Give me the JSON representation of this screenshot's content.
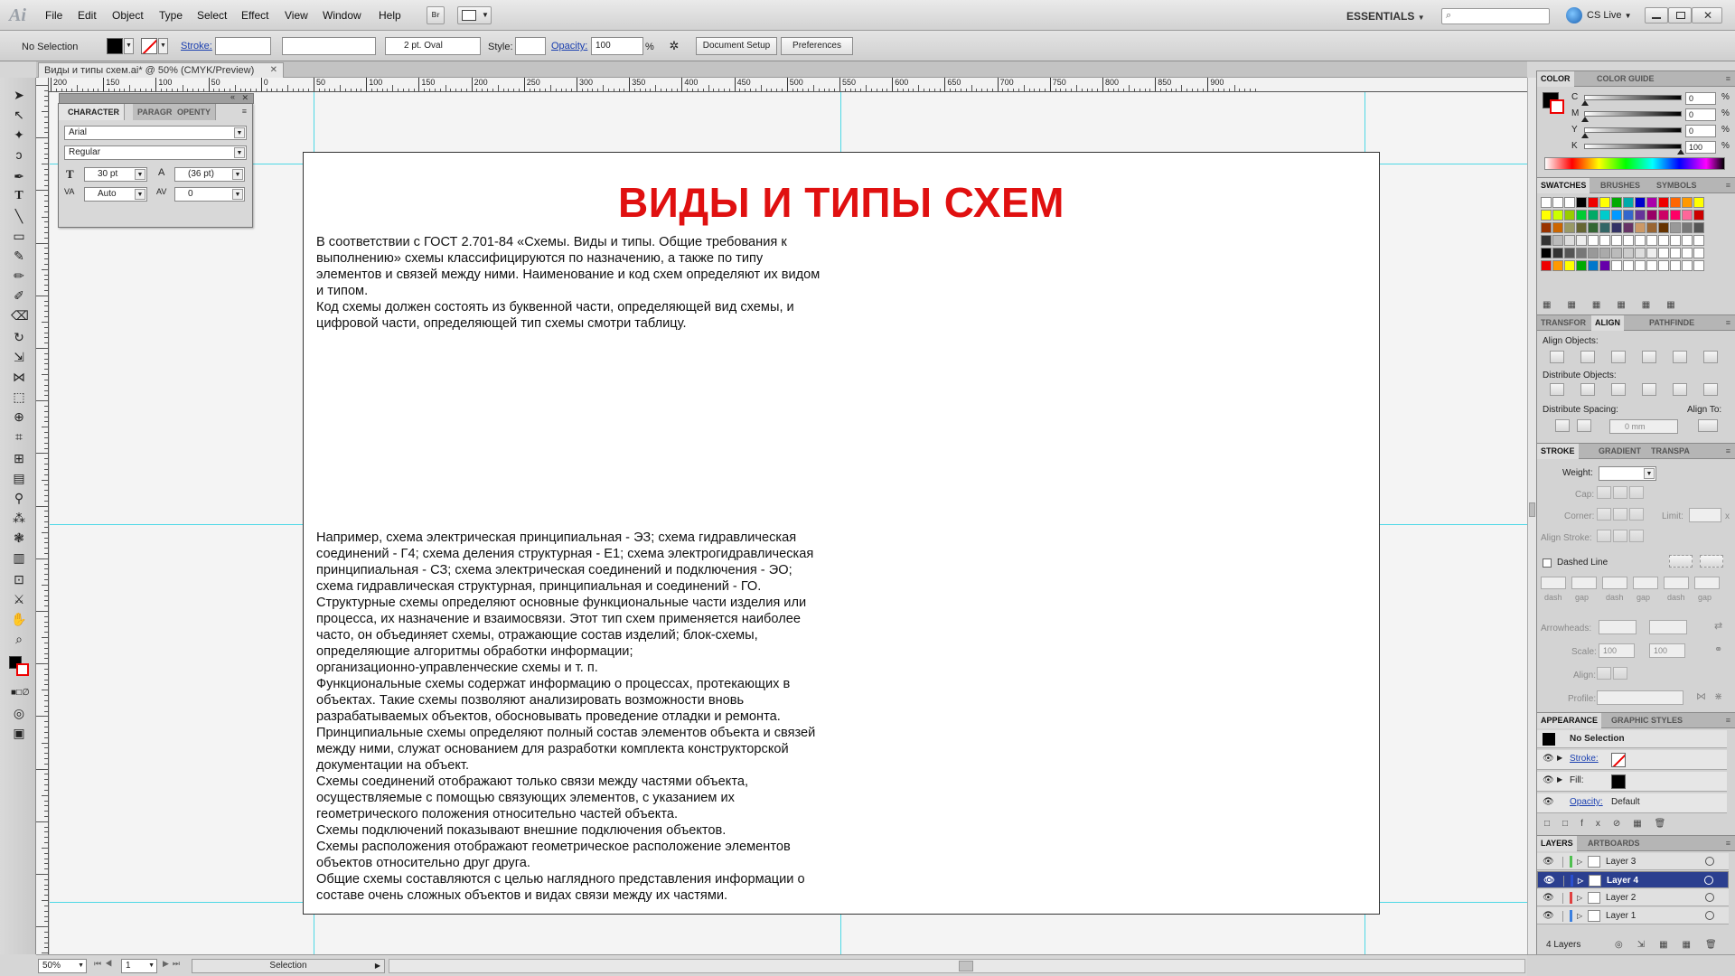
{
  "app": {
    "logo": "Ai",
    "menus": [
      "File",
      "Edit",
      "Object",
      "Type",
      "Select",
      "Effect",
      "View",
      "Window",
      "Help"
    ],
    "workspace": "ESSENTIALS",
    "cs_live": "CS Live"
  },
  "control_bar": {
    "selection": "No Selection",
    "stroke_label": "Stroke:",
    "brush": "2 pt. Oval",
    "style_label": "Style:",
    "opacity_label": "Opacity:",
    "opacity_value": "100",
    "opacity_unit": "%",
    "doc_setup": "Document Setup",
    "preferences": "Preferences"
  },
  "document": {
    "tab_title": "Виды и типы схем.ai* @ 50% (CMYK/Preview)",
    "title": "ВИДЫ И ТИПЫ СХЕМ",
    "text_block_1": "В соответствии с ГОСТ 2.701-84 «Схемы. Виды и типы. Общие требования к\nвыполнению» схемы классифицируются по назначению, а также по типу\nэлементов и связей между ними. Наименование и код схем определяют их видом\nи типом.\nКод схемы должен состоять из буквенной части, определяющей вид схемы, и\nцифровой части, определяющей тип схемы смотри таблицу.",
    "text_block_2": "Например, схема электрическая принципиальная - ЭЗ; схема гидравлическая\nсоединений - Г4; схема деления структурная - Е1; схема электрогидравлическая\nпринципиальная - СЗ; схема электрическая соединений и подключения - ЭО;\nсхема гидравлическая структурная, принципиальная и соединений - ГО.\nСтруктурные схемы определяют основные функциональные части изделия или\nпроцесса, их назначение и взаимосвязи. Этот тип схем применяется наиболее\nчасто, он объединяет схемы, отражающие состав изделий; блок-схемы,\nопределяющие алгоритмы обработки информации;\nорганизационно-управленческие схемы и т. п.\nФункциональные схемы содержат информацию о процессах, протекающих в\nобъектах. Такие схемы позволяют анализировать возможности вновь\nразрабатываемых объектов, обосновывать проведение отладки и ремонта.\nПринципиальные схемы определяют полный состав элементов объекта и связей\nмежду ними, служат основанием для разработки комплекта конструкторской\nдокументации на объект.\nСхемы соединений отображают только связи между частями объекта,\nосуществляемые с помощью связующих элементов, с указанием их\nгеометрического положения относительно частей объекта.\nСхемы подключений показывают внешние подключения объектов.\nСхемы расположения отображают геометрическое расположение элементов\nобъектов относительно друг друга.\nОбщие схемы составляются с целью наглядного представления информации о\nсоставе очень сложных объектов и видах связи между их частями."
  },
  "ruler": {
    "labels": [
      "200",
      "150",
      "100",
      "50",
      "0",
      "50",
      "100",
      "150",
      "200",
      "250",
      "300",
      "350",
      "400",
      "450",
      "500",
      "550",
      "600",
      "650",
      "700",
      "750",
      "800",
      "850",
      "900"
    ]
  },
  "character_panel": {
    "tabs": [
      "CHARACTER",
      "PARAGR",
      "OPENTY"
    ],
    "font": "Arial",
    "style": "Regular",
    "size": "30 pt",
    "leading": "(36 pt)",
    "kerning": "Auto",
    "tracking": "0"
  },
  "color_panel": {
    "tabs": [
      "COLOR",
      "COLOR GUIDE"
    ],
    "channels": [
      {
        "label": "C",
        "value": "0",
        "pct": 0
      },
      {
        "label": "M",
        "value": "0",
        "pct": 0
      },
      {
        "label": "Y",
        "value": "0",
        "pct": 0
      },
      {
        "label": "K",
        "value": "100",
        "pct": 100
      }
    ],
    "unit": "%"
  },
  "swatches_panel": {
    "tabs": [
      "SWATCHES",
      "BRUSHES",
      "SYMBOLS"
    ]
  },
  "align_panel": {
    "tabs": [
      "TRANSFOR",
      "ALIGN",
      "PATHFINDE"
    ],
    "align_objects": "Align Objects:",
    "distribute_objects": "Distribute Objects:",
    "distribute_spacing": "Distribute Spacing:",
    "align_to": "Align To:",
    "spacing_value": "0 mm"
  },
  "stroke_panel": {
    "tabs": [
      "STROKE",
      "GRADIENT",
      "TRANSPA"
    ],
    "weight": "Weight:",
    "cap": "Cap:",
    "corner": "Corner:",
    "limit": "Limit:",
    "limit_x": "x",
    "align_stroke": "Align Stroke:",
    "dashed_line": "Dashed Line",
    "dash_labels": [
      "dash",
      "gap",
      "dash",
      "gap",
      "dash",
      "gap"
    ],
    "arrowheads": "Arrowheads:",
    "scale": "Scale:",
    "scale_values": [
      "100",
      "100"
    ],
    "align": "Align:",
    "profile": "Profile:"
  },
  "appearance_panel": {
    "tabs": [
      "APPEARANCE",
      "GRAPHIC STYLES"
    ],
    "selection": "No Selection",
    "stroke": "Stroke:",
    "fill": "Fill:",
    "opacity": "Opacity:",
    "opacity_value": "Default"
  },
  "layers_panel": {
    "tabs": [
      "LAYERS",
      "ARTBOARDS"
    ],
    "layers": [
      {
        "name": "Layer 3",
        "color": "#4fc04f",
        "selected": false
      },
      {
        "name": "Layer 4",
        "color": "#2a4fd0",
        "selected": true
      },
      {
        "name": "Layer 2",
        "color": "#e04040",
        "selected": false
      },
      {
        "name": "Layer 1",
        "color": "#3a7fe0",
        "selected": false
      }
    ],
    "count": "4 Layers"
  },
  "status": {
    "zoom": "50%",
    "artboard": "1",
    "tool": "Selection"
  }
}
